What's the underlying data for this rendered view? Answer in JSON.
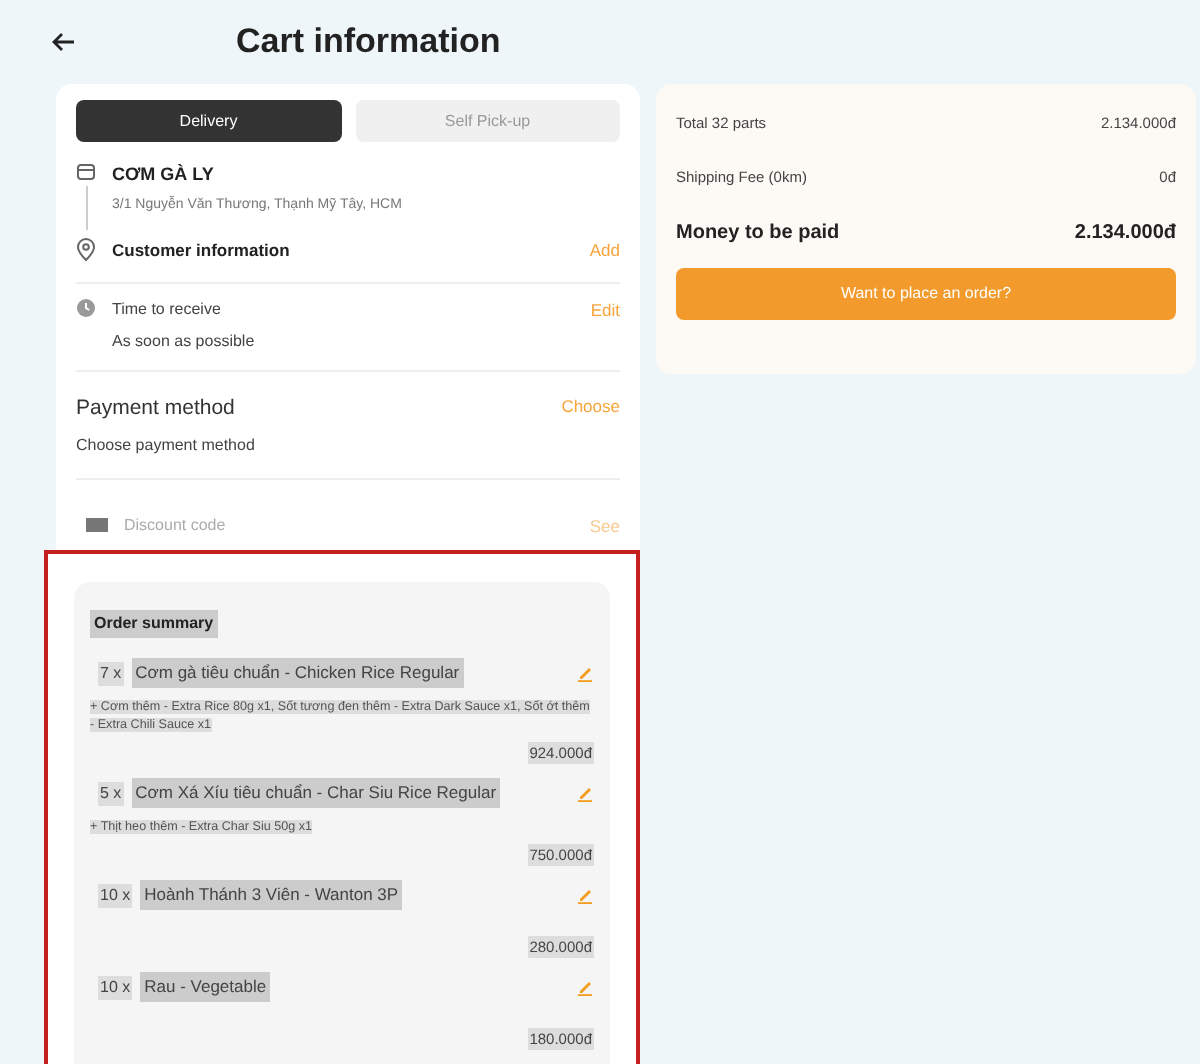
{
  "header": {
    "title": "Cart information"
  },
  "tabs": [
    {
      "label": "Delivery",
      "selected": true
    },
    {
      "label": "Self Pick-up",
      "selected": false
    }
  ],
  "store": {
    "name": "CƠM GÀ LY",
    "address": "3/1 Nguyễn Văn Thương, Thạnh Mỹ Tây, HCM"
  },
  "customer": {
    "label": "Customer information",
    "action": "Add"
  },
  "time": {
    "label": "Time to receive",
    "value": "As soon as possible",
    "action": "Edit"
  },
  "payment": {
    "label": "Payment method",
    "value": "Choose payment method",
    "action": "Choose"
  },
  "discount": {
    "label": "Discount code",
    "action": "See"
  },
  "order_summary": {
    "title": "Order summary",
    "items": [
      {
        "qty": "7 x",
        "name": "Cơm gà tiêu chuẩn - Chicken Rice Regular",
        "options": "+ Cơm thêm - Extra Rice 80g x1, Sốt tương đen thêm - Extra Dark Sauce x1, Sốt ớt thêm - Extra Chili Sauce x1",
        "price": "924.000đ"
      },
      {
        "qty": "5 x",
        "name": "Cơm Xá Xíu tiêu chuẩn - Char Siu Rice Regular",
        "options": "+ Thịt heo thêm - Extra Char Siu 50g x1",
        "price": "750.000đ"
      },
      {
        "qty": "10 x",
        "name": "Hoành Thánh 3 Viên - Wanton 3P",
        "price": "280.000đ"
      },
      {
        "qty": "10 x",
        "name": "Rau - Vegetable",
        "price": "180.000đ"
      }
    ]
  },
  "totals": {
    "rows": [
      {
        "label": "Total 32 parts",
        "value": "2.134.000đ"
      },
      {
        "label": "Shipping Fee (0km)",
        "value": "0đ"
      }
    ],
    "grand_label": "Money to be paid",
    "grand_value": "2.134.000đ",
    "button": "Want to place an order?"
  }
}
